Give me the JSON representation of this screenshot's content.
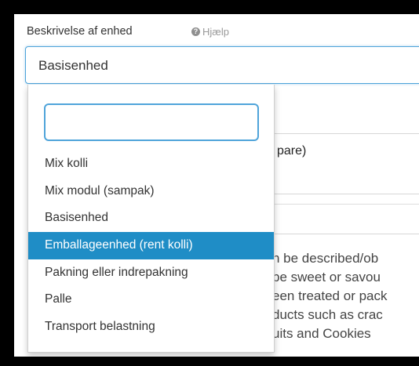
{
  "field": {
    "label": "Beskrivelse af enhed",
    "help_label": "Hjælp",
    "selected_value": "Basisenhed"
  },
  "dropdown": {
    "search_value": "",
    "options": [
      {
        "label": "Mix kolli",
        "selected": false
      },
      {
        "label": "Mix modul (sampak)",
        "selected": false
      },
      {
        "label": "Basisenhed",
        "selected": false
      },
      {
        "label": "Emballageenhed (rent kolli)",
        "selected": true
      },
      {
        "label": "Pakning eller indrepakning",
        "selected": false
      },
      {
        "label": "Palle",
        "selected": false
      },
      {
        "label": "Transport belastning",
        "selected": false
      }
    ]
  },
  "background": {
    "partial_label": "pare)",
    "description_lines": [
      "n be described/ob",
      "be sweet or savou",
      "een treated or pack",
      "ducts such as crac",
      "uits and Cookies"
    ]
  },
  "colors": {
    "accent": "#1f8dc6",
    "focus_border": "#4fa4da"
  }
}
